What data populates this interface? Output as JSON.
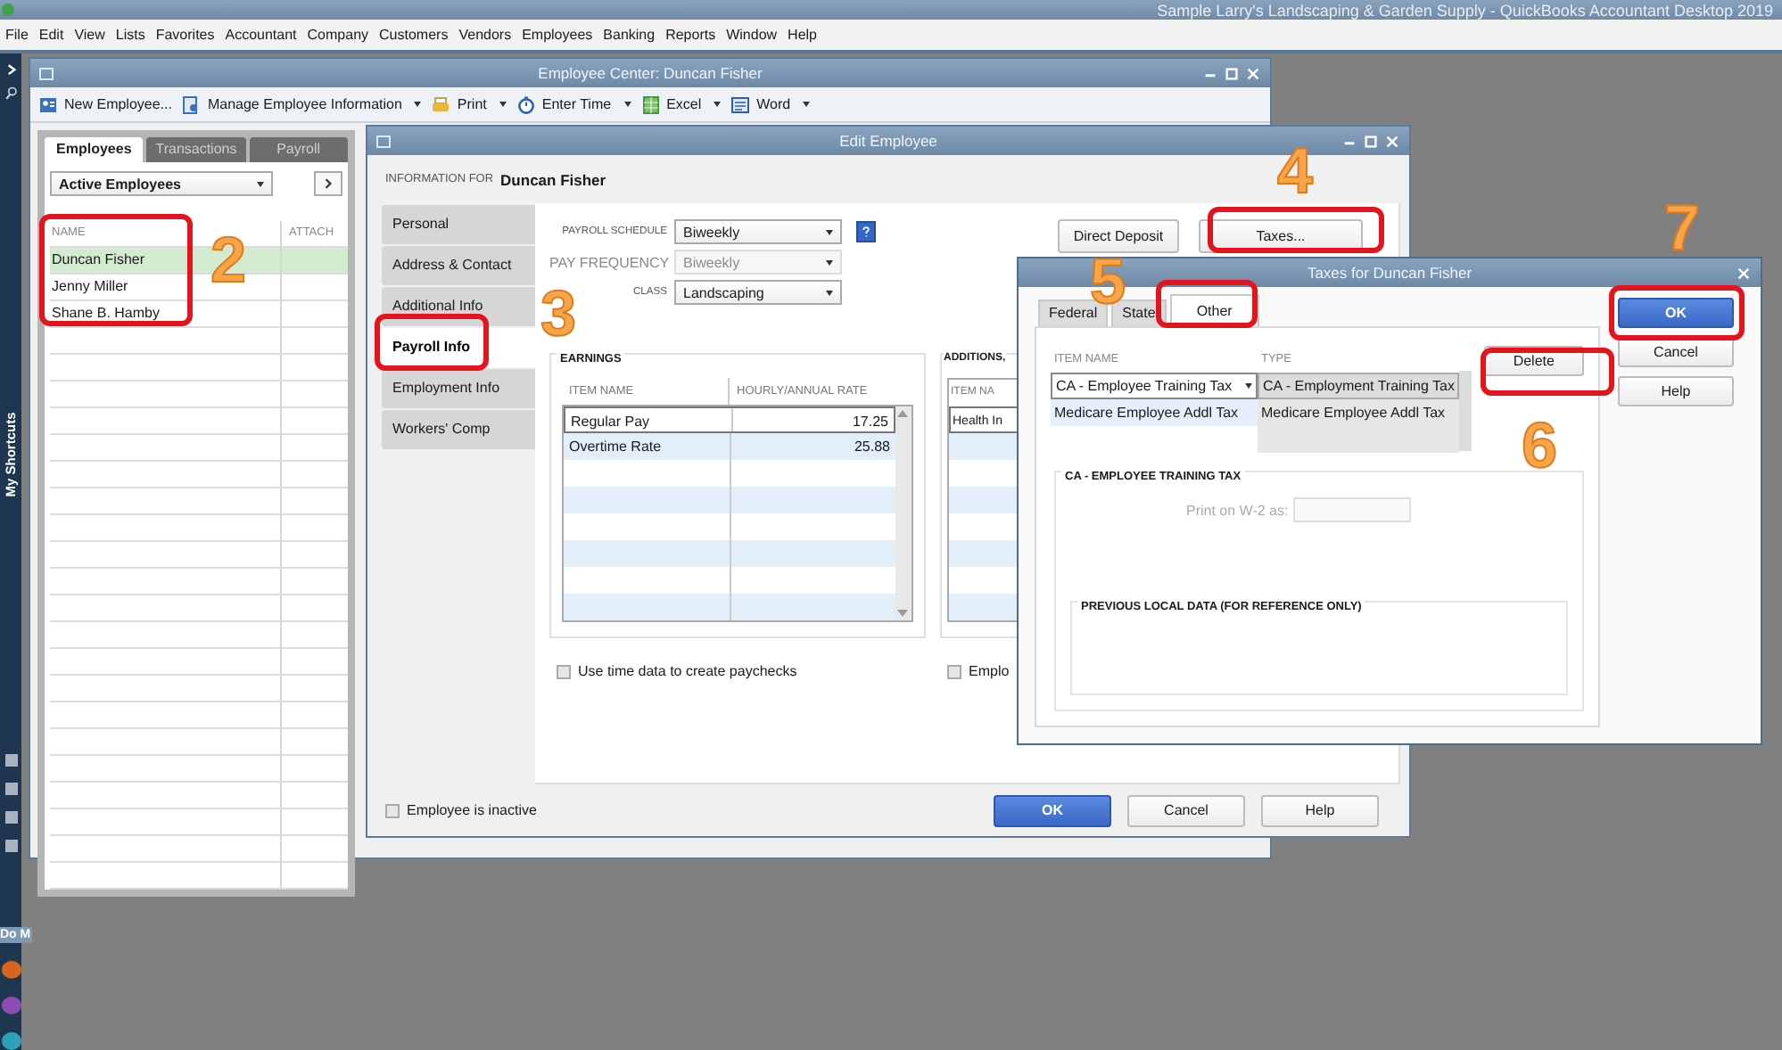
{
  "app_title": "Sample Larry's Landscaping & Garden Supply  - QuickBooks Accountant Desktop 2019",
  "menu": [
    "File",
    "Edit",
    "View",
    "Lists",
    "Favorites",
    "Accountant",
    "Company",
    "Customers",
    "Vendors",
    "Employees",
    "Banking",
    "Reports",
    "Window",
    "Help"
  ],
  "sidebar": {
    "label": "My Shortcuts",
    "section": "Do M"
  },
  "employee_center": {
    "title": "Employee Center: Duncan Fisher",
    "toolbar": [
      {
        "label": "New Employee...",
        "dropdown": false
      },
      {
        "label": "Manage Employee Information",
        "dropdown": true
      },
      {
        "label": "Print",
        "dropdown": true
      },
      {
        "label": "Enter Time",
        "dropdown": true
      },
      {
        "label": "Excel",
        "dropdown": true
      },
      {
        "label": "Word",
        "dropdown": true
      }
    ],
    "tabs": [
      {
        "label": "Employees",
        "selected": true
      },
      {
        "label": "Transactions",
        "selected": false
      },
      {
        "label": "Payroll",
        "selected": false
      }
    ],
    "filter": "Active Employees",
    "columns": [
      "NAME",
      "ATTACH"
    ],
    "rows": [
      {
        "name": "Duncan Fisher",
        "selected": true
      },
      {
        "name": "Jenny Miller",
        "selected": false
      },
      {
        "name": "Shane B. Hamby",
        "selected": false
      }
    ]
  },
  "edit_employee": {
    "title": "Edit Employee",
    "info_label": "INFORMATION FOR",
    "employee_name": "Duncan Fisher",
    "nav": [
      {
        "label": "Personal",
        "selected": false
      },
      {
        "label": "Address & Contact",
        "selected": false
      },
      {
        "label": "Additional Info",
        "selected": false
      },
      {
        "label": "Payroll Info",
        "selected": true
      },
      {
        "label": "Employment Info",
        "selected": false
      },
      {
        "label": "Workers' Comp",
        "selected": false
      }
    ],
    "fields": [
      {
        "label": "PAYROLL SCHEDULE",
        "value": "Biweekly",
        "disabled": false,
        "help": true
      },
      {
        "label": "PAY FREQUENCY",
        "value": "Biweekly",
        "disabled": true,
        "help": false
      },
      {
        "label": "CLASS",
        "value": "Landscaping",
        "disabled": false,
        "help": false
      }
    ],
    "top_buttons": [
      "Direct Deposit",
      "Taxes..."
    ],
    "earnings": {
      "title": "EARNINGS",
      "columns": [
        "ITEM NAME",
        "HOURLY/ANNUAL RATE"
      ],
      "rows": [
        {
          "item": "Regular Pay",
          "rate": "17.25"
        },
        {
          "item": "Overtime Rate",
          "rate": "25.88"
        }
      ]
    },
    "additions": {
      "title": "ADDITIONS,",
      "column": "ITEM NA",
      "rows": [
        "Health In"
      ]
    },
    "checkboxes": [
      {
        "label": "Use time data to create paychecks",
        "checked": false
      },
      {
        "label": "Emplo",
        "checked": false
      }
    ],
    "inactive": {
      "label": "Employee is inactive",
      "checked": false
    },
    "buttons": [
      {
        "label": "OK",
        "primary": true
      },
      {
        "label": "Cancel",
        "primary": false
      },
      {
        "label": "Help",
        "primary": false
      }
    ]
  },
  "taxes": {
    "title": "Taxes for Duncan Fisher",
    "tabs": [
      {
        "label": "Federal",
        "selected": false
      },
      {
        "label": "State",
        "selected": false
      },
      {
        "label": "Other",
        "selected": true
      }
    ],
    "columns": [
      "ITEM NAME",
      "TYPE"
    ],
    "rows": [
      {
        "item": "CA - Employee Training Tax",
        "type": "CA - Employment Training Tax",
        "editing": true
      },
      {
        "item": "Medicare Employee Addl Tax",
        "type": "Medicare Employee Addl Tax",
        "editing": false
      }
    ],
    "delete_button": "Delete",
    "group_title": "CA - EMPLOYEE TRAINING TAX",
    "print_label": "Print on W-2 as:",
    "subgroup_title": "PREVIOUS LOCAL DATA (FOR REFERENCE ONLY)",
    "buttons": [
      {
        "label": "OK",
        "primary": true
      },
      {
        "label": "Cancel",
        "primary": false
      },
      {
        "label": "Help",
        "primary": false
      }
    ]
  },
  "annotations": [
    {
      "label": "2"
    },
    {
      "label": "3"
    },
    {
      "label": "4"
    },
    {
      "label": "5"
    },
    {
      "label": "6"
    },
    {
      "label": "7"
    }
  ]
}
